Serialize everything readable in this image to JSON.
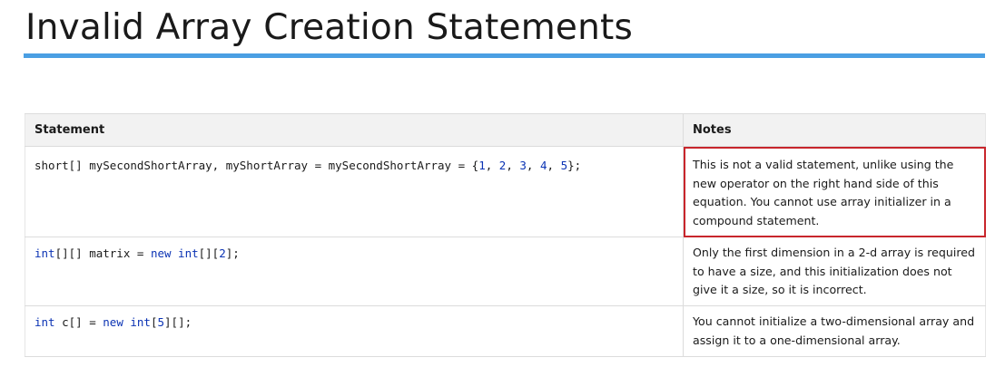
{
  "page": {
    "title": "Invalid Array Creation Statements"
  },
  "table": {
    "headers": {
      "statement": "Statement",
      "notes": "Notes"
    },
    "rows": [
      {
        "statement_tokens": [
          {
            "t": "short",
            "k": "plain"
          },
          {
            "t": "[] mySecondShortArray, myShortArray = mySecondShortArray = {",
            "k": "plain"
          },
          {
            "t": "1",
            "k": "num"
          },
          {
            "t": ", ",
            "k": "plain"
          },
          {
            "t": "2",
            "k": "num"
          },
          {
            "t": ", ",
            "k": "plain"
          },
          {
            "t": "3",
            "k": "num"
          },
          {
            "t": ", ",
            "k": "plain"
          },
          {
            "t": "4",
            "k": "num"
          },
          {
            "t": ", ",
            "k": "plain"
          },
          {
            "t": "5",
            "k": "num"
          },
          {
            "t": "};",
            "k": "plain"
          }
        ],
        "note": "This is not a valid statement, unlike using the new operator on the right hand side of this equation.  You cannot use array initializer in a compound statement.",
        "highlighted": true
      },
      {
        "statement_tokens": [
          {
            "t": "int",
            "k": "kw"
          },
          {
            "t": "[][] matrix = ",
            "k": "plain"
          },
          {
            "t": "new",
            "k": "kw"
          },
          {
            "t": " ",
            "k": "plain"
          },
          {
            "t": "int",
            "k": "kw"
          },
          {
            "t": "[][",
            "k": "plain"
          },
          {
            "t": "2",
            "k": "num"
          },
          {
            "t": "];",
            "k": "plain"
          }
        ],
        "note": "Only the first dimension in a 2-d array is required to have a size, and this initialization does not give it a size, so it is incorrect.",
        "highlighted": false
      },
      {
        "statement_tokens": [
          {
            "t": "int",
            "k": "kw"
          },
          {
            "t": " c[] = ",
            "k": "plain"
          },
          {
            "t": "new",
            "k": "kw"
          },
          {
            "t": " ",
            "k": "plain"
          },
          {
            "t": "int",
            "k": "kw"
          },
          {
            "t": "[",
            "k": "plain"
          },
          {
            "t": "5",
            "k": "num"
          },
          {
            "t": "][];",
            "k": "plain"
          }
        ],
        "note": "You cannot initialize a two-dimensional array and assign it to a one-dimensional array.",
        "highlighted": false
      }
    ]
  },
  "colors": {
    "title_rule": "#4a9fe3",
    "highlight_border": "#c8262c",
    "keyword": "#0b33b4",
    "header_bg": "#f2f2f2"
  }
}
